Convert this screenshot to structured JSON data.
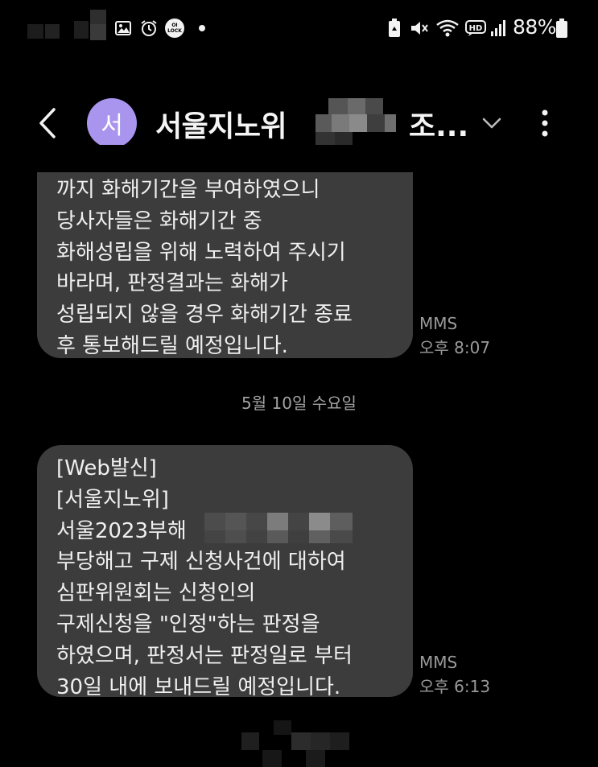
{
  "status_bar": {
    "battery_percent": "88%",
    "left_icons": [
      "gallery-icon",
      "alarm-icon",
      "lock-app-icon",
      "notification-dot-icon"
    ],
    "lock_badge_text": "OI LOCK",
    "right_icons": [
      "battery-saver-icon",
      "mute-icon",
      "wifi-icon",
      "hd-voice-icon",
      "signal-icon",
      "battery-icon"
    ]
  },
  "header": {
    "avatar_initial": "서",
    "contact_name": "서울지노위",
    "contact_name_suffix": "조...",
    "back_icon": "back-chevron-icon",
    "expand_icon": "chevron-down-icon",
    "more_icon": "more-vertical-icon",
    "avatar_color": "#a995ee"
  },
  "messages": [
    {
      "lines": [
        "까지 화해기간을 부여하였으니",
        "당사자들은 화해기간 중",
        "화해성립을 위해 노력하여 주시기",
        "바라며, 판정결과는 화해가",
        "성립되지 않을 경우 화해기간 종료",
        "후 통보해드릴 예정입니다."
      ],
      "type": "MMS",
      "time": "오후 8:07"
    },
    {
      "lines": [
        "[Web발신]",
        "[서울지노위]",
        "서울2023부해",
        "부당해고 구제 신청사건에 대하여",
        "심판위원회는 신청인의",
        "구제신청을 \"인정\"하는 판정을",
        "하였으며, 판정서는 판정일로 부터",
        "30일 내에 보내드릴 예정입니다."
      ],
      "type": "MMS",
      "time": "오후 6:13"
    }
  ],
  "date_divider": "5월 10일 수요일",
  "colors": {
    "background": "#000000",
    "bubble": "#3c3c3c",
    "meta_text": "#9a9a9a"
  }
}
